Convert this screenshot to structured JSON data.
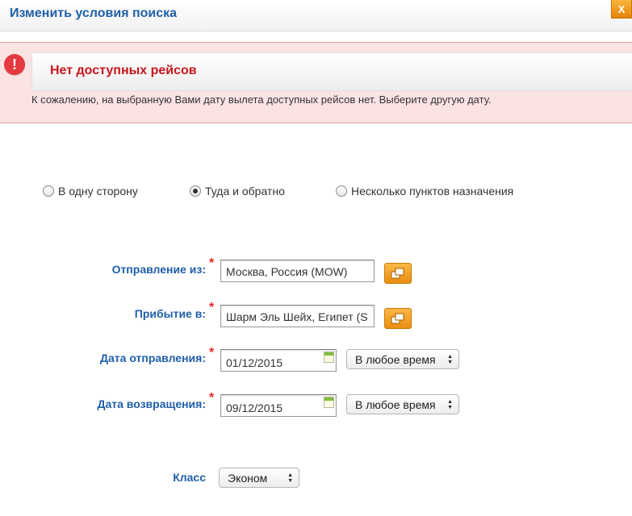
{
  "dialog": {
    "title": "Изменить условия поиска",
    "close_label": "X"
  },
  "error": {
    "icon": "exclamation-icon",
    "icon_glyph": "!",
    "title": "Нет доступных рейсов",
    "message": "К сожалению, на выбранную Вами дату вылета доступных рейсов нет. Выберите другую дату."
  },
  "trip_type": {
    "options": [
      {
        "label": "В одну сторону",
        "checked": false
      },
      {
        "label": "Туда и обратно",
        "checked": true
      },
      {
        "label": "Несколько пунктов назначения",
        "checked": false
      }
    ]
  },
  "form": {
    "required_mark": "*",
    "origin": {
      "label": "Отправление из:",
      "value": "Москва, Россия (MOW)"
    },
    "destination": {
      "label": "Прибытие в:",
      "value": "Шарм Эль Шейх, Египет (S"
    },
    "departure_date": {
      "label": "Дата отправления:",
      "value": "01/12/2015",
      "time": "В любое время"
    },
    "return_date": {
      "label": "Дата возвращения:",
      "value": "09/12/2015",
      "time": "В любое время"
    },
    "cabin_class": {
      "label": "Класс",
      "value": "Эконом"
    }
  },
  "colors": {
    "accent": "#1f5fa8",
    "error": "#c8161d",
    "banner_bg": "#fbe3e4",
    "button": "#ea8c10"
  }
}
